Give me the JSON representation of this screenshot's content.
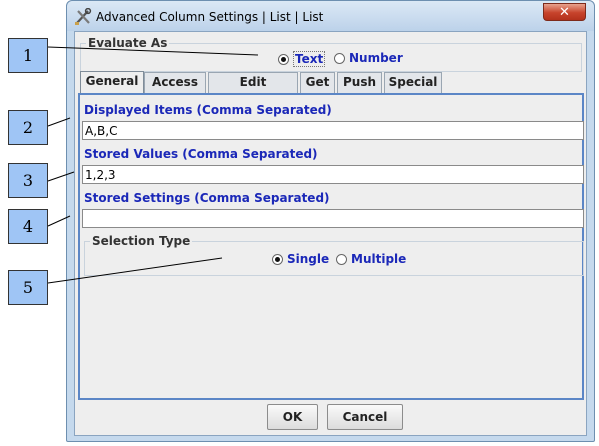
{
  "window": {
    "title": "Advanced Column Settings | List | List",
    "close_label": "✕"
  },
  "evaluate_as": {
    "title": "Evaluate As",
    "options": [
      {
        "label": "Text",
        "selected": true
      },
      {
        "label": "Number",
        "selected": false
      }
    ]
  },
  "tabs": [
    {
      "label": "General",
      "active": true
    },
    {
      "label": "Access",
      "active": false
    },
    {
      "label": "Edit Auditing",
      "active": false
    },
    {
      "label": "Get",
      "active": false
    },
    {
      "label": "Push",
      "active": false
    },
    {
      "label": "Special",
      "active": false
    }
  ],
  "general": {
    "displayed_items_label": "Displayed Items (Comma Separated)",
    "displayed_items_value": "A,B,C",
    "stored_values_label": "Stored Values (Comma Separated)",
    "stored_values_value": "1,2,3",
    "stored_settings_label": "Stored Settings (Comma Separated)",
    "stored_settings_value": "",
    "selection_type": {
      "title": "Selection Type",
      "options": [
        {
          "label": "Single",
          "selected": true
        },
        {
          "label": "Multiple",
          "selected": false
        }
      ]
    }
  },
  "buttons": {
    "ok": "OK",
    "cancel": "Cancel"
  },
  "callouts": [
    "1",
    "2",
    "3",
    "4",
    "5"
  ],
  "colors": {
    "label_blue": "#1b28b8",
    "panel_border": "#5b86c6",
    "callout_fill": "#9fc5f5"
  }
}
